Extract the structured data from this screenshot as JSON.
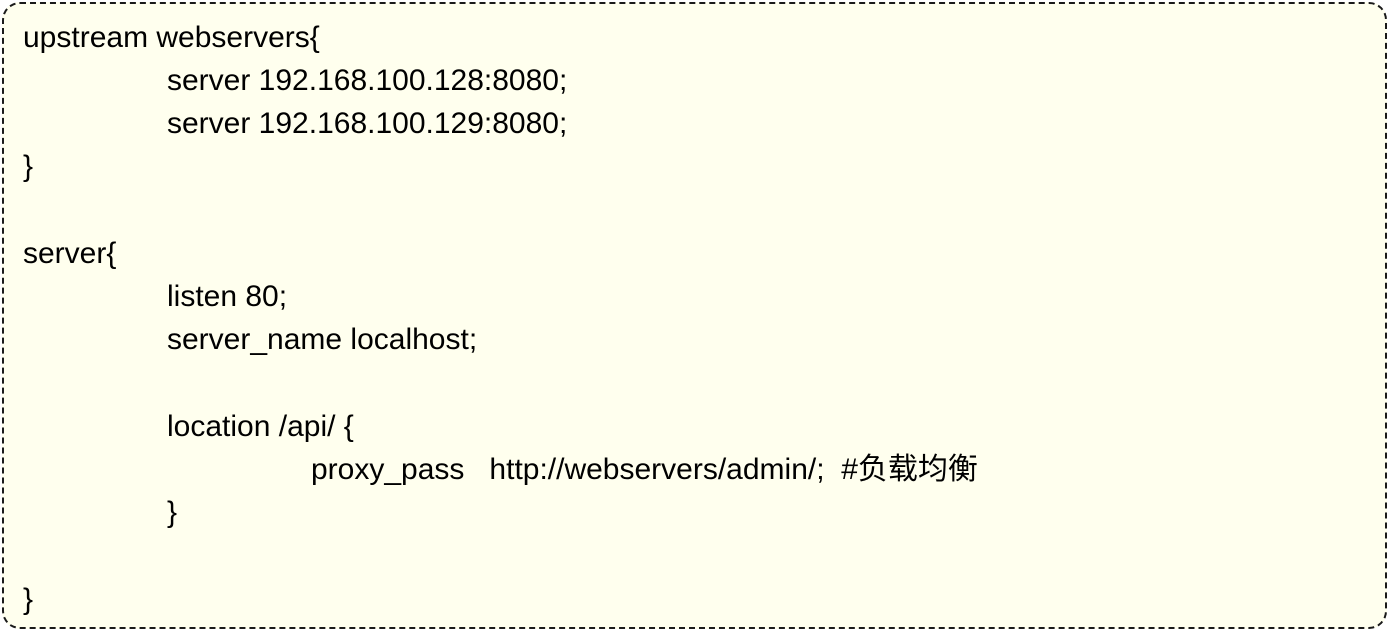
{
  "code": {
    "lines": [
      "upstream webservers{",
      "server 192.168.100.128:8080;",
      "server 192.168.100.129:8080;",
      "}",
      "server{",
      "listen 80;",
      "server_name localhost;",
      "location /api/ {",
      "proxy_pass   http://webservers/admin/;  #负载均衡",
      "}",
      "}"
    ]
  }
}
